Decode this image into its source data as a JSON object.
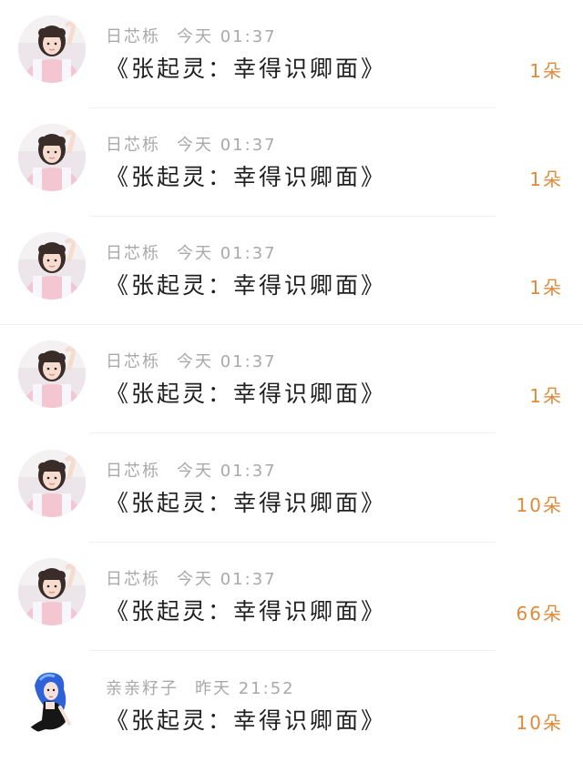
{
  "items": [
    {
      "author": "日芯栎",
      "time": "今天 01:37",
      "title": "《张起灵：幸得识卿面》",
      "count": "1朵",
      "avatar_icon": "girl-portrait-avatar"
    },
    {
      "author": "日芯栎",
      "time": "今天 01:37",
      "title": "《张起灵：幸得识卿面》",
      "count": "1朵",
      "avatar_icon": "girl-portrait-avatar"
    },
    {
      "author": "日芯栎",
      "time": "今天 01:37",
      "title": "《张起灵：幸得识卿面》",
      "count": "1朵",
      "avatar_icon": "girl-portrait-avatar"
    },
    {
      "author": "日芯栎",
      "time": "今天 01:37",
      "title": "《张起灵：幸得识卿面》",
      "count": "1朵",
      "avatar_icon": "girl-portrait-avatar"
    },
    {
      "author": "日芯栎",
      "time": "今天 01:37",
      "title": "《张起灵：幸得识卿面》",
      "count": "10朵",
      "avatar_icon": "girl-portrait-avatar"
    },
    {
      "author": "日芯栎",
      "time": "今天 01:37",
      "title": "《张起灵：幸得识卿面》",
      "count": "66朵",
      "avatar_icon": "girl-portrait-avatar"
    },
    {
      "author": "亲亲籽子",
      "time": "昨天 21:52",
      "title": "《张起灵：幸得识卿面》",
      "count": "10朵",
      "avatar_icon": "blue-hair-girl-avatar"
    }
  ],
  "colors": {
    "count": "#e08a3a",
    "meta": "#a9a9a9",
    "title": "#1f1f1f"
  }
}
